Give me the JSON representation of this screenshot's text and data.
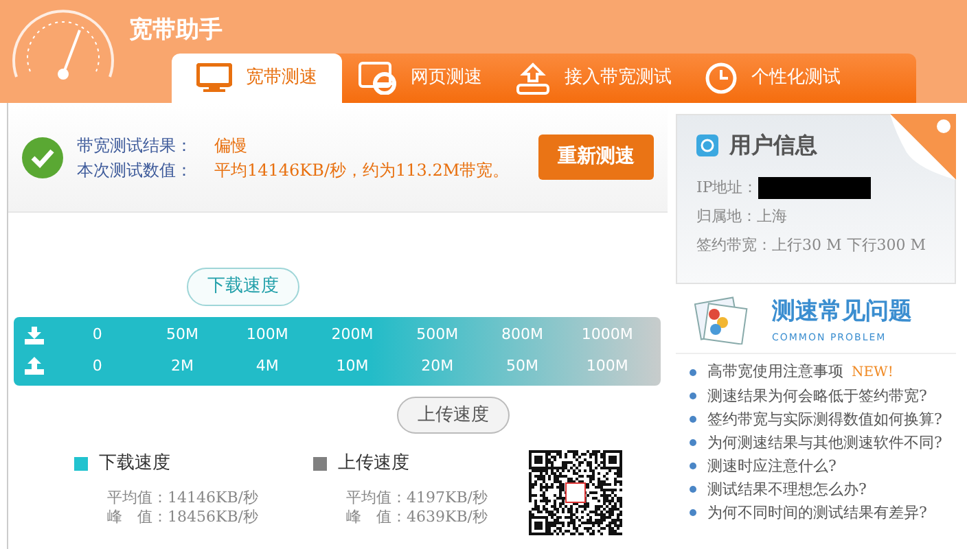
{
  "app": {
    "title": "宽带助手"
  },
  "tabs": [
    {
      "label": "宽带测速",
      "selected": true
    },
    {
      "label": "网页测速",
      "selected": false
    },
    {
      "label": "接入带宽测试",
      "selected": false
    },
    {
      "label": "个性化测试",
      "selected": false
    }
  ],
  "result": {
    "status_label": "带宽测试结果：",
    "status_value": "偏慢",
    "value_label": "本次测试数值：",
    "value_text": "平均14146KB/秒，约为113.2M带宽。",
    "button": "重新测速"
  },
  "speed_scale": {
    "download_label": "下载速度",
    "upload_label": "上传速度",
    "download_ticks": [
      "0",
      "50M",
      "100M",
      "200M",
      "500M",
      "800M",
      "1000M"
    ],
    "upload_ticks": [
      "0",
      "2M",
      "4M",
      "10M",
      "20M",
      "50M",
      "100M"
    ]
  },
  "legend": [
    {
      "label": "下载速度",
      "color": "#22c3cf",
      "average": "平均值：14146KB/秒",
      "peak": "峰　值：18456KB/秒"
    },
    {
      "label": "上传速度",
      "color": "#808080",
      "average": "平均值：4197KB/秒",
      "peak": "峰　值：4639KB/秒"
    }
  ],
  "user_info": {
    "title": "用户信息",
    "fields": [
      {
        "label": "IP地址：",
        "redacted": true
      },
      {
        "label": "归属地：",
        "value": "上海"
      },
      {
        "label": "签约带宽：",
        "value": "上行30 M 下行300 M"
      }
    ]
  },
  "faq": {
    "title": "测速常见问题",
    "subtitle": "COMMON PROBLEM",
    "items": [
      {
        "text": "高带宽使用注意事项",
        "badge": "NEW!"
      },
      {
        "text": "测速结果为何会略低于签约带宽?"
      },
      {
        "text": "签约带宽与实际测得数值如何换算?"
      },
      {
        "text": "为何测速结果与其他测速软件不同?"
      },
      {
        "text": "测速时应注意什么?"
      },
      {
        "text": "测试结果不理想怎么办?"
      },
      {
        "text": "为何不同时间的测试结果有差异?"
      }
    ]
  }
}
